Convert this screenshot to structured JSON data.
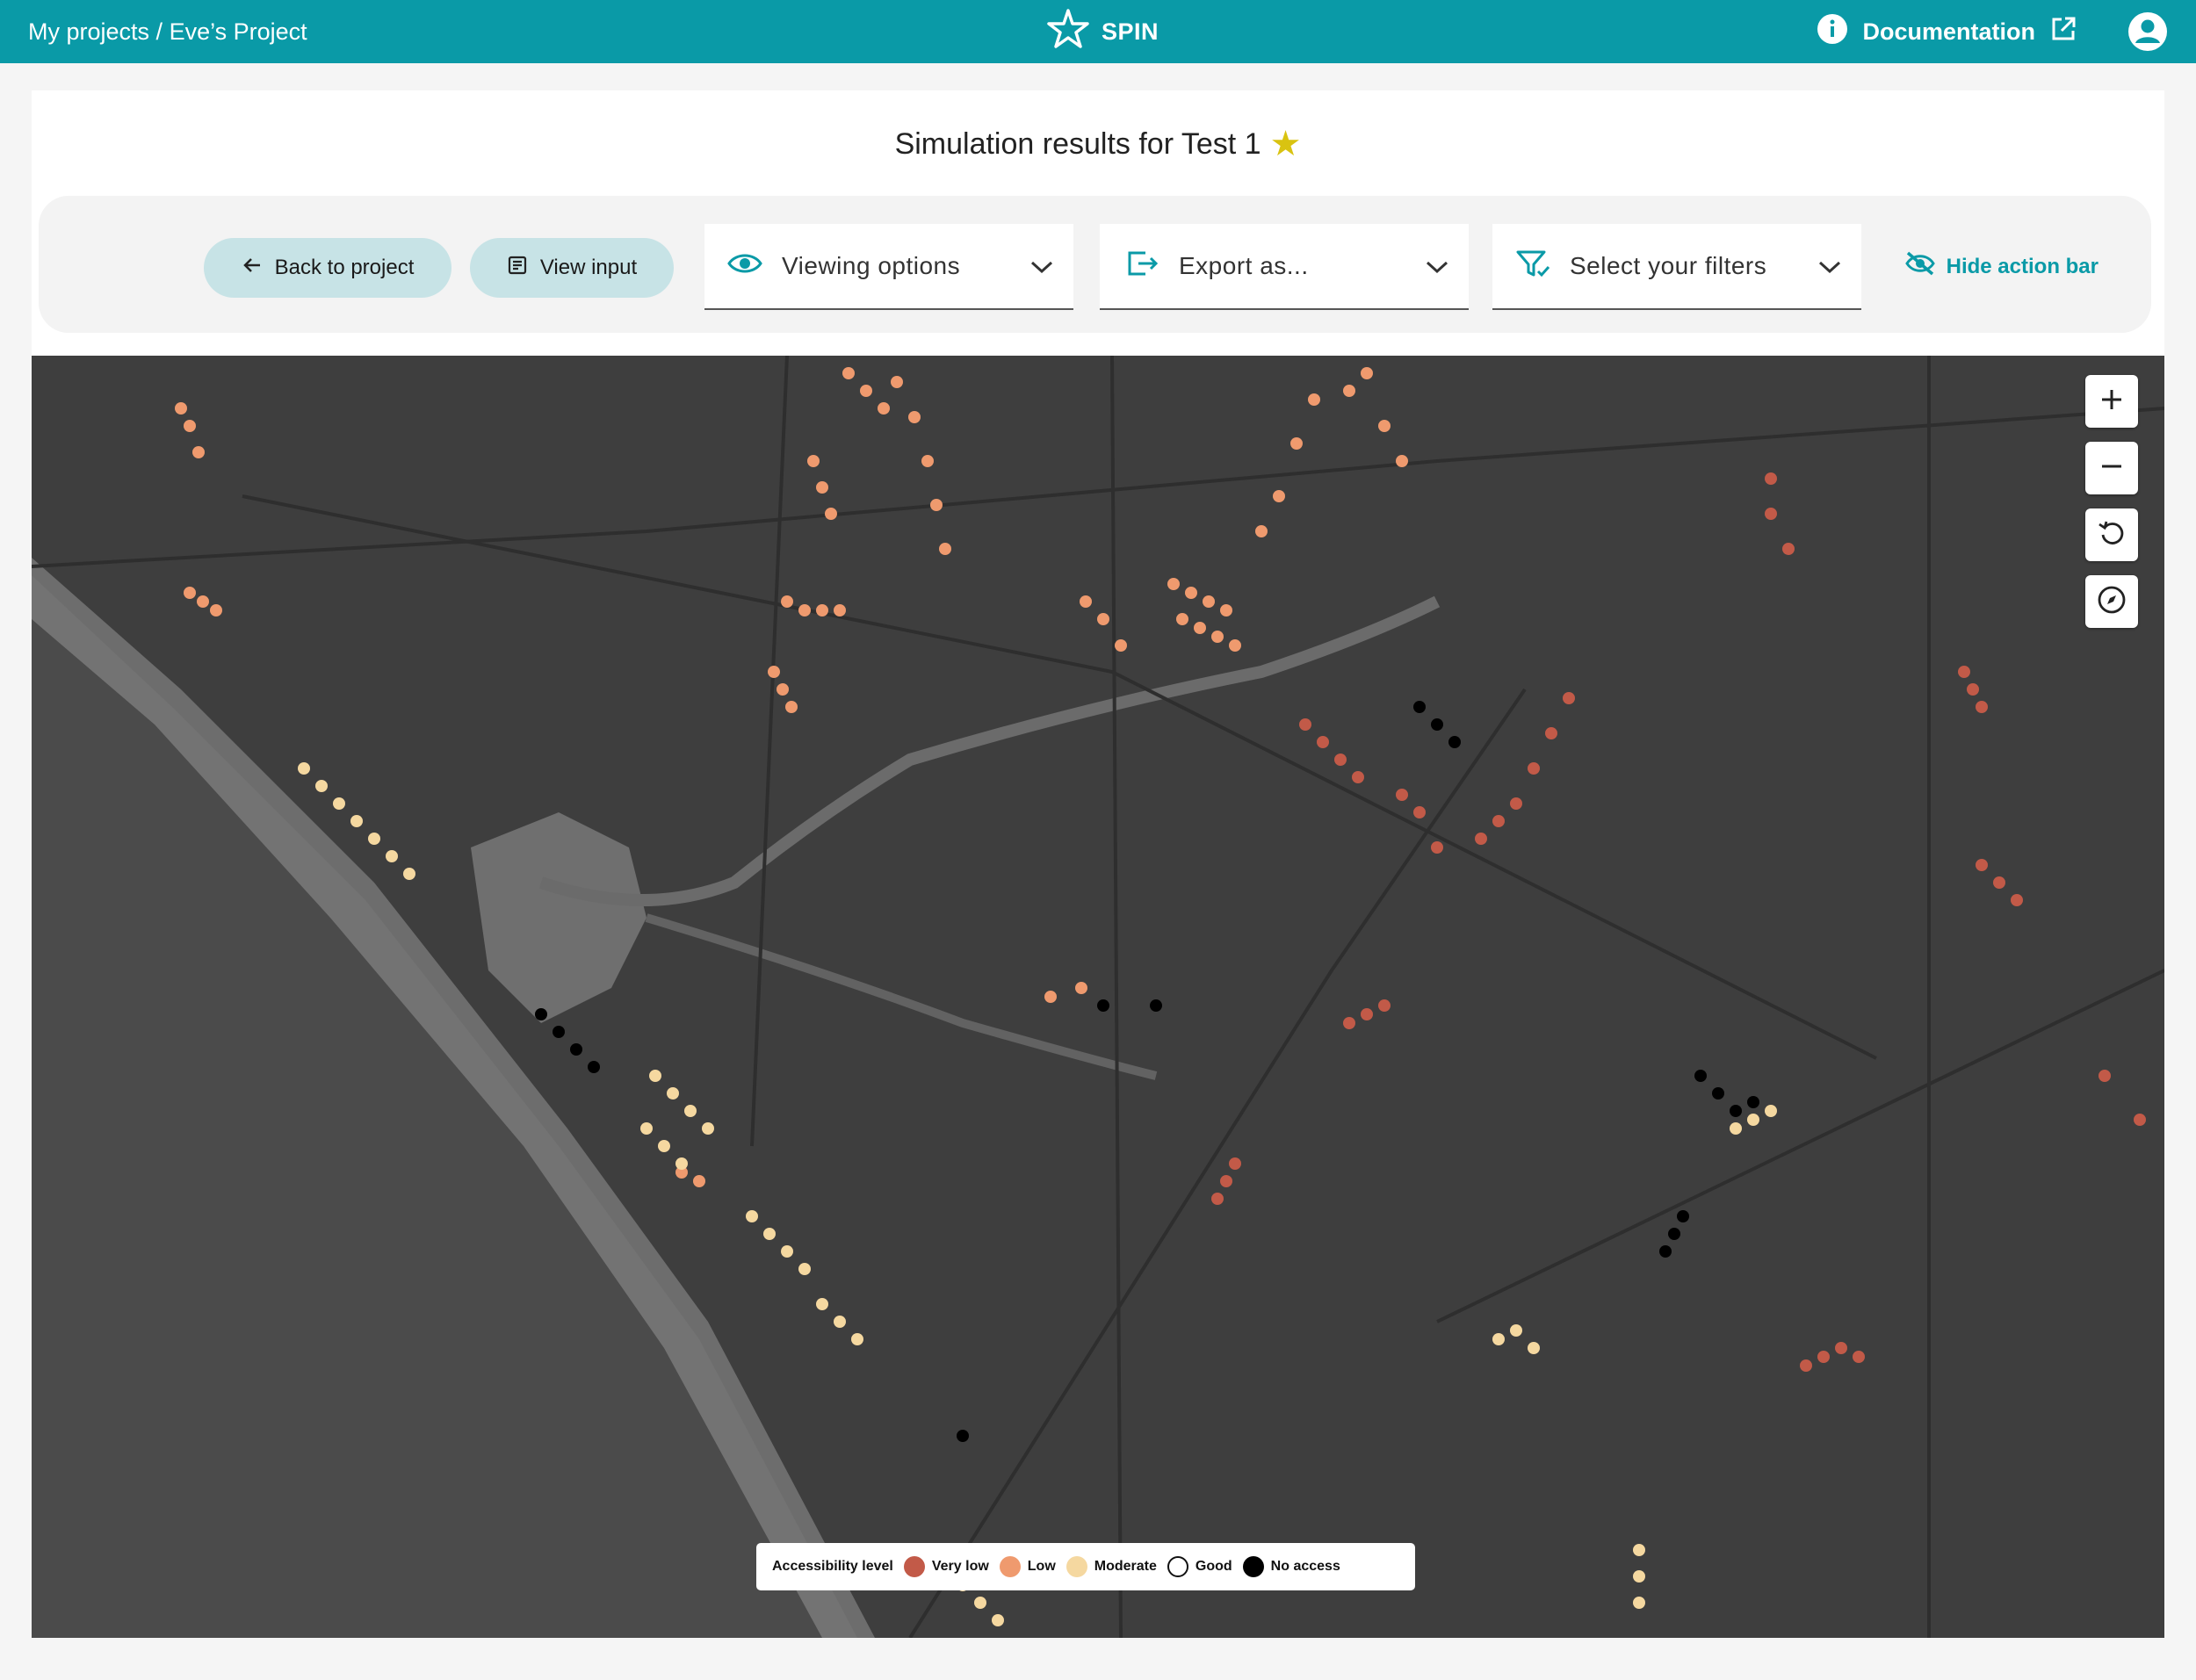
{
  "header": {
    "breadcrumb_root": "My projects",
    "breadcrumb_sep": " / ",
    "breadcrumb_current": "Eve’s Project",
    "brand": "SPIN",
    "documentation": "Documentation"
  },
  "page": {
    "title": "Simulation results for Test 1"
  },
  "actions": {
    "back": "Back to project",
    "view_input": "View input",
    "viewing_options": "Viewing options",
    "export": "Export as...",
    "filters": "Select your filters",
    "hide_bar": "Hide action bar"
  },
  "map": {
    "controls": [
      "zoom-in",
      "zoom-out",
      "reset-rotation",
      "compass"
    ],
    "legend": {
      "title": "Accessibility level",
      "items": [
        {
          "label": "Very low",
          "color": "#c25a48"
        },
        {
          "label": "Low",
          "color": "#ef9a6e"
        },
        {
          "label": "Moderate",
          "color": "#f5d8a0"
        },
        {
          "label": "Good",
          "color": "#ffffff"
        },
        {
          "label": "No access",
          "color": "#000000"
        }
      ]
    }
  },
  "colors": {
    "topbar": "#0a9aa7",
    "accent": "#0a9aa7",
    "star": "#d9c311"
  }
}
